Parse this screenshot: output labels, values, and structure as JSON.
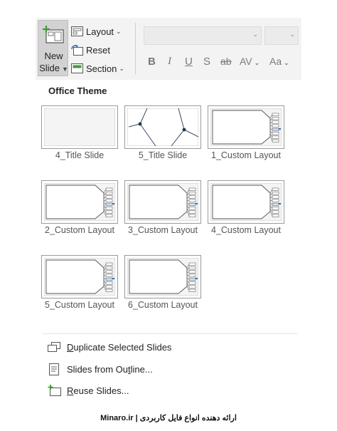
{
  "ribbon": {
    "new_slide": {
      "line1": "New",
      "line2": "Slide",
      "icon": "new-slide-icon"
    },
    "layout_label": "Layout",
    "reset_label": "Reset",
    "section_label": "Section",
    "format": {
      "bold": "B",
      "italic": "I",
      "underline": "U",
      "shadow": "S",
      "strike": "ab",
      "spacing": "AV",
      "case": "Aa"
    }
  },
  "gallery": {
    "title": "Office Theme",
    "layouts": [
      {
        "label": "4_Title Slide",
        "kind": "blank"
      },
      {
        "label": "5_Title Slide",
        "kind": "network"
      },
      {
        "label": "1_Custom Layout",
        "kind": "custom"
      },
      {
        "label": "2_Custom Layout",
        "kind": "custom"
      },
      {
        "label": "3_Custom Layout",
        "kind": "custom"
      },
      {
        "label": "4_Custom Layout",
        "kind": "custom"
      },
      {
        "label": "5_Custom Layout",
        "kind": "custom"
      },
      {
        "label": "6_Custom Layout",
        "kind": "custom"
      }
    ]
  },
  "menu": [
    {
      "label": "Duplicate Selected Slides",
      "icon": "duplicate-slides-icon"
    },
    {
      "label": "Slides from Outline...",
      "icon": "outline-document-icon"
    },
    {
      "label": "Reuse Slides...",
      "icon": "reuse-slides-icon"
    }
  ],
  "footer": "Minaro.ir | ارائه دهنده انواع فایل کاربردی",
  "colors": {
    "ribbon_bg": "#f3f3f3",
    "selected_bg": "#d2d2d2",
    "accent_green": "#3f9c35",
    "accent_blue": "#2f6fb3"
  }
}
